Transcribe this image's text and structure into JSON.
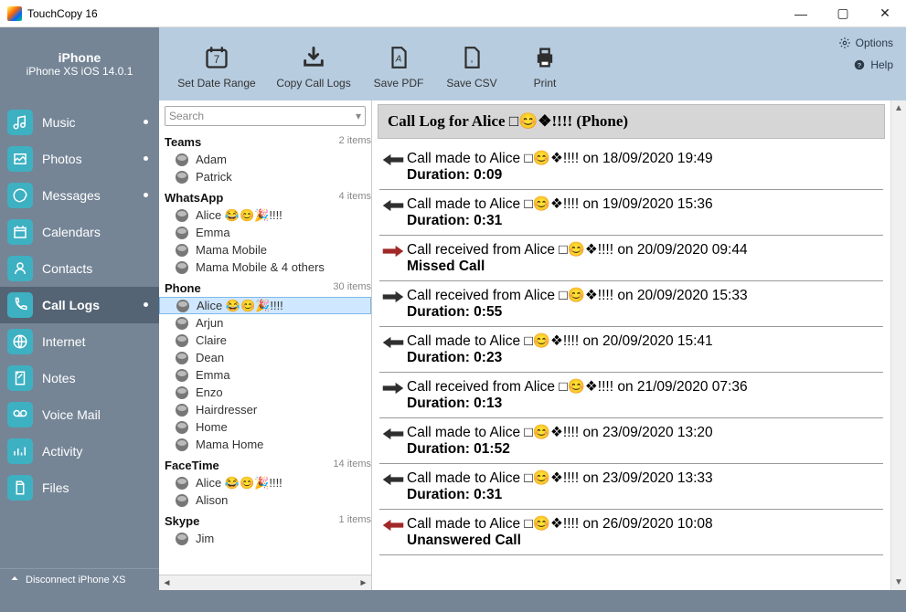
{
  "app_title": "TouchCopy 16",
  "window_controls": {
    "min": "—",
    "max": "▢",
    "close": "✕"
  },
  "device": {
    "name": "iPhone",
    "detail": "iPhone XS iOS 14.0.1"
  },
  "toolbar": {
    "set_date_range": "Set Date Range",
    "copy_call_logs": "Copy Call Logs",
    "save_pdf": "Save PDF",
    "save_csv": "Save CSV",
    "print": "Print",
    "options": "Options",
    "help": "Help"
  },
  "sidebar": {
    "items": [
      {
        "label": "Music",
        "dot": true
      },
      {
        "label": "Photos",
        "dot": true
      },
      {
        "label": "Messages",
        "dot": true
      },
      {
        "label": "Calendars",
        "dot": false
      },
      {
        "label": "Contacts",
        "dot": false
      },
      {
        "label": "Call Logs",
        "dot": true,
        "active": true
      },
      {
        "label": "Internet",
        "dot": false
      },
      {
        "label": "Notes",
        "dot": false
      },
      {
        "label": "Voice Mail",
        "dot": false
      },
      {
        "label": "Activity",
        "dot": false
      },
      {
        "label": "Files",
        "dot": false
      }
    ],
    "disconnect": "Disconnect iPhone XS"
  },
  "search_placeholder": "Search",
  "contact_groups": [
    {
      "name": "Teams",
      "count": "2 items",
      "contacts": [
        "Adam",
        "Patrick"
      ]
    },
    {
      "name": "WhatsApp",
      "count": "4 items",
      "contacts": [
        "Alice 😂😊🎉!!!!",
        "Emma",
        "Mama Mobile",
        "Mama Mobile & 4 others"
      ]
    },
    {
      "name": "Phone",
      "count": "30 items",
      "contacts": [
        "Alice 😂😊🎉!!!!",
        "Arjun",
        "Claire",
        "Dean",
        "Emma",
        "Enzo",
        "Hairdresser",
        "Home",
        "Mama Home"
      ],
      "selected_index": 0
    },
    {
      "name": "FaceTime",
      "count": "14 items",
      "contacts": [
        "Alice 😂😊🎉!!!!",
        "Alison"
      ]
    },
    {
      "name": "Skype",
      "count": "1 items",
      "contacts": [
        "Jim"
      ]
    }
  ],
  "log_header": "Call Log for Alice □😊❖!!!! (Phone)",
  "log_entries": [
    {
      "dir": "out",
      "color": "black",
      "line1": "Call made to Alice □😊❖!!!! on 18/09/2020 19:49",
      "line2": "Duration: 0:09"
    },
    {
      "dir": "out",
      "color": "black",
      "line1": "Call made to Alice □😊❖!!!! on 19/09/2020 15:36",
      "line2": "Duration: 0:31"
    },
    {
      "dir": "in",
      "color": "red",
      "line1": "Call received from Alice □😊❖!!!! on 20/09/2020 09:44",
      "line2": "Missed Call"
    },
    {
      "dir": "in",
      "color": "black",
      "line1": "Call received from Alice □😊❖!!!! on 20/09/2020 15:33",
      "line2": "Duration: 0:55"
    },
    {
      "dir": "out",
      "color": "black",
      "line1": "Call made to Alice □😊❖!!!! on 20/09/2020 15:41",
      "line2": "Duration: 0:23"
    },
    {
      "dir": "in",
      "color": "black",
      "line1": "Call received from Alice □😊❖!!!! on 21/09/2020 07:36",
      "line2": "Duration: 0:13"
    },
    {
      "dir": "out",
      "color": "black",
      "line1": "Call made to Alice □😊❖!!!! on 23/09/2020 13:20",
      "line2": "Duration: 01:52"
    },
    {
      "dir": "out",
      "color": "black",
      "line1": "Call made to Alice □😊❖!!!! on 23/09/2020 13:33",
      "line2": "Duration: 0:31"
    },
    {
      "dir": "out",
      "color": "red",
      "line1": "Call made to Alice □😊❖!!!! on 26/09/2020 10:08",
      "line2": "Unanswered Call"
    }
  ]
}
